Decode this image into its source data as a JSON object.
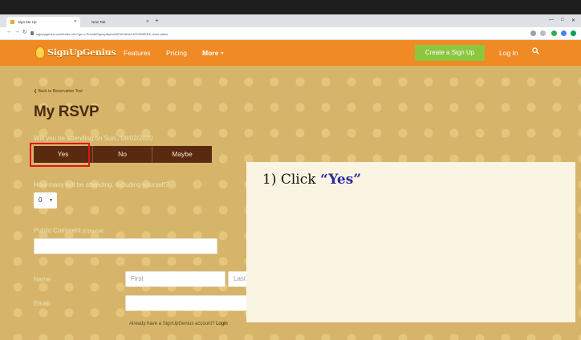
{
  "browser": {
    "tabs": [
      {
        "label": "Sign Me Up",
        "active": true
      },
      {
        "label": "New Tab",
        "active": false
      }
    ],
    "new_tab_glyph": "+",
    "url": "signupgenius.com/index.cfm?go=c.PrivateSignupByInfo#ENCANACATONWEEK-reservation",
    "window_controls": [
      "—",
      "□",
      "✕"
    ]
  },
  "header": {
    "logo_text": "SignUpGenius",
    "nav": [
      "Features",
      "Pricing",
      "More"
    ],
    "create_button": "Create a Sign Up",
    "login_link": "Log In",
    "colors": {
      "header": "#f08a24",
      "create": "#8cc63f"
    }
  },
  "form": {
    "back_link": "Back to Reservation Test",
    "title": "My RSVP",
    "attending_question": "Will you be attending on Sun., 08/02/2020",
    "rsvp_options": [
      "Yes",
      "No",
      "Maybe"
    ],
    "count_question": "How many will be attending, including yourself?",
    "count_value": "0",
    "comment_label": "Public Comment",
    "comment_optional": "(Optional)",
    "name_label": "Name",
    "first_placeholder": "First",
    "last_placeholder": "Last",
    "email_label": "Email",
    "account_prompt": "Already have a SignUpGenius account?",
    "login_link": "Login"
  },
  "instruction": {
    "prefix": "1) Click ",
    "emphasis": "“Yes”"
  }
}
